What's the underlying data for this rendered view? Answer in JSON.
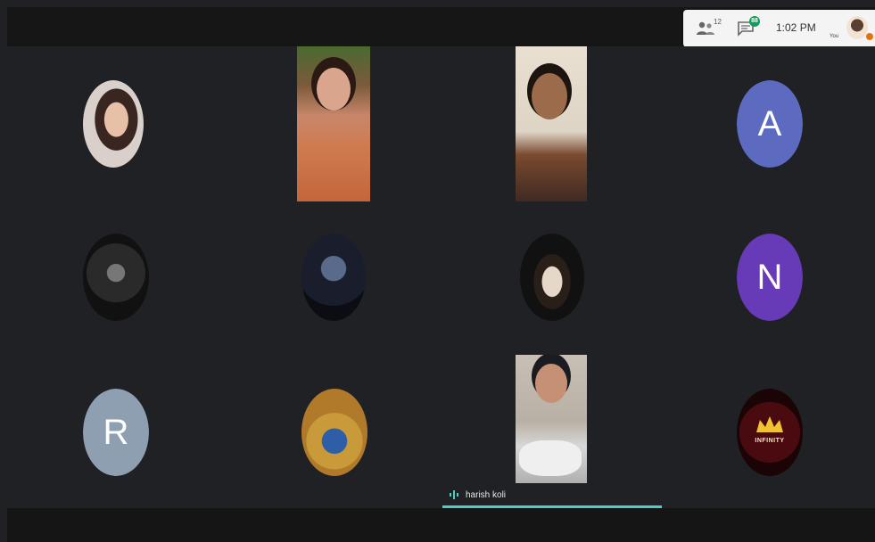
{
  "header": {
    "people_count": "12",
    "chat_count": "88",
    "time": "1:02 PM",
    "you_label": "You"
  },
  "participants": [
    {
      "initial": "A",
      "color": "#5c6bc0"
    },
    {
      "initial": "N",
      "color": "#673ab7"
    },
    {
      "initial": "R",
      "color": "#8d9fb0"
    }
  ],
  "infinity_logo": "INFINITY",
  "speaker": {
    "name": "harish koli",
    "accent": "#4ecdc4"
  },
  "icons": [
    "people-icon",
    "chat-icon",
    "audio-wave-icon",
    "crown-icon"
  ]
}
